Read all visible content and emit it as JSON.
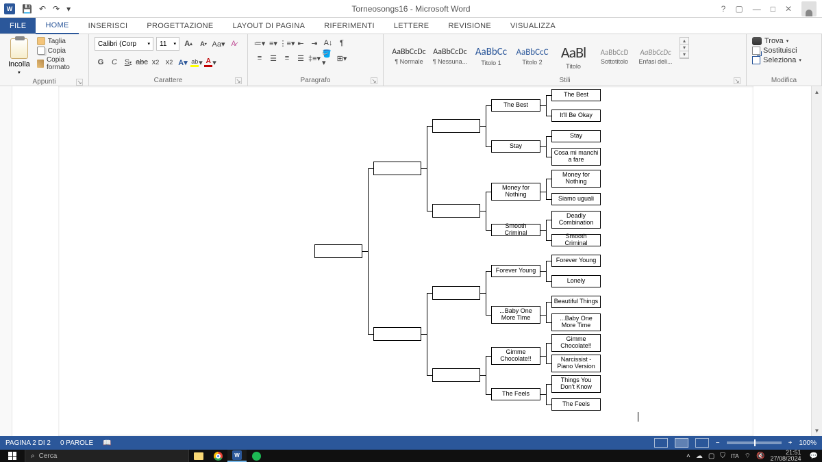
{
  "window_title": "Torneosongs16 - Microsoft Word",
  "qa": {
    "save": "💾",
    "undo": "↶",
    "redo": "↷"
  },
  "tabs": [
    "FILE",
    "HOME",
    "INSERISCI",
    "PROGETTAZIONE",
    "LAYOUT DI PAGINA",
    "RIFERIMENTI",
    "LETTERE",
    "REVISIONE",
    "VISUALIZZA"
  ],
  "ribbon": {
    "clipboard": {
      "label": "Appunti",
      "paste": "Incolla",
      "cut": "Taglia",
      "copy": "Copia",
      "format": "Copia formato"
    },
    "font": {
      "label": "Carattere",
      "family": "Calibri (Corp",
      "size": "11"
    },
    "paragraph": {
      "label": "Paragrafo"
    },
    "styles": {
      "label": "Stili",
      "items": [
        {
          "sample": "AaBbCcDc",
          "name": "¶ Normale",
          "ss": "font-size:12px;color:#333;"
        },
        {
          "sample": "AaBbCcDc",
          "name": "¶ Nessuna...",
          "ss": "font-size:12px;color:#333;"
        },
        {
          "sample": "AaBbCc",
          "name": "Titolo 1",
          "ss": "font-size:15px;color:#2b579a;"
        },
        {
          "sample": "AaBbCcC",
          "name": "Titolo 2",
          "ss": "font-size:13px;color:#2b579a;"
        },
        {
          "sample": "AaBl",
          "name": "Titolo",
          "ss": "font-size:22px;color:#333;letter-spacing:-1px;"
        },
        {
          "sample": "AaBbCcD",
          "name": "Sottotitolo",
          "ss": "font-size:11px;color:#888;"
        },
        {
          "sample": "AaBbCcDc",
          "name": "Enfasi deli...",
          "ss": "font-size:11px;color:#888;font-style:italic;"
        }
      ]
    },
    "editing": {
      "label": "Modifica",
      "find": "Trova",
      "replace": "Sostituisci",
      "select": "Seleziona"
    }
  },
  "bracket": {
    "col5": [
      "The Best",
      "It'll Be Okay",
      "Stay",
      "Cosa mi manchi a fare",
      "Money for Nothing",
      "Siamo uguali",
      "Deadly Combination",
      "Smooth Criminal",
      "Forever Young",
      "Lonely",
      "Beautiful Things",
      "...Baby One More Time",
      "Gimme Chocolate!!",
      "Narcissist - Piano Version",
      "Things You Don't Know",
      "The Feels"
    ],
    "col4": [
      "The Best",
      "Stay",
      "Money for Nothing",
      "Smooth Criminal",
      "Forever Young",
      "...Baby One More Time",
      "Gimme Chocolate!!",
      "The Feels"
    ]
  },
  "status": {
    "page": "PAGINA 2 DI 2",
    "words": "0 PAROLE",
    "zoom": "100%"
  },
  "taskbar": {
    "search_placeholder": "Cerca",
    "time": "21:51",
    "date": "27/08/2024"
  }
}
